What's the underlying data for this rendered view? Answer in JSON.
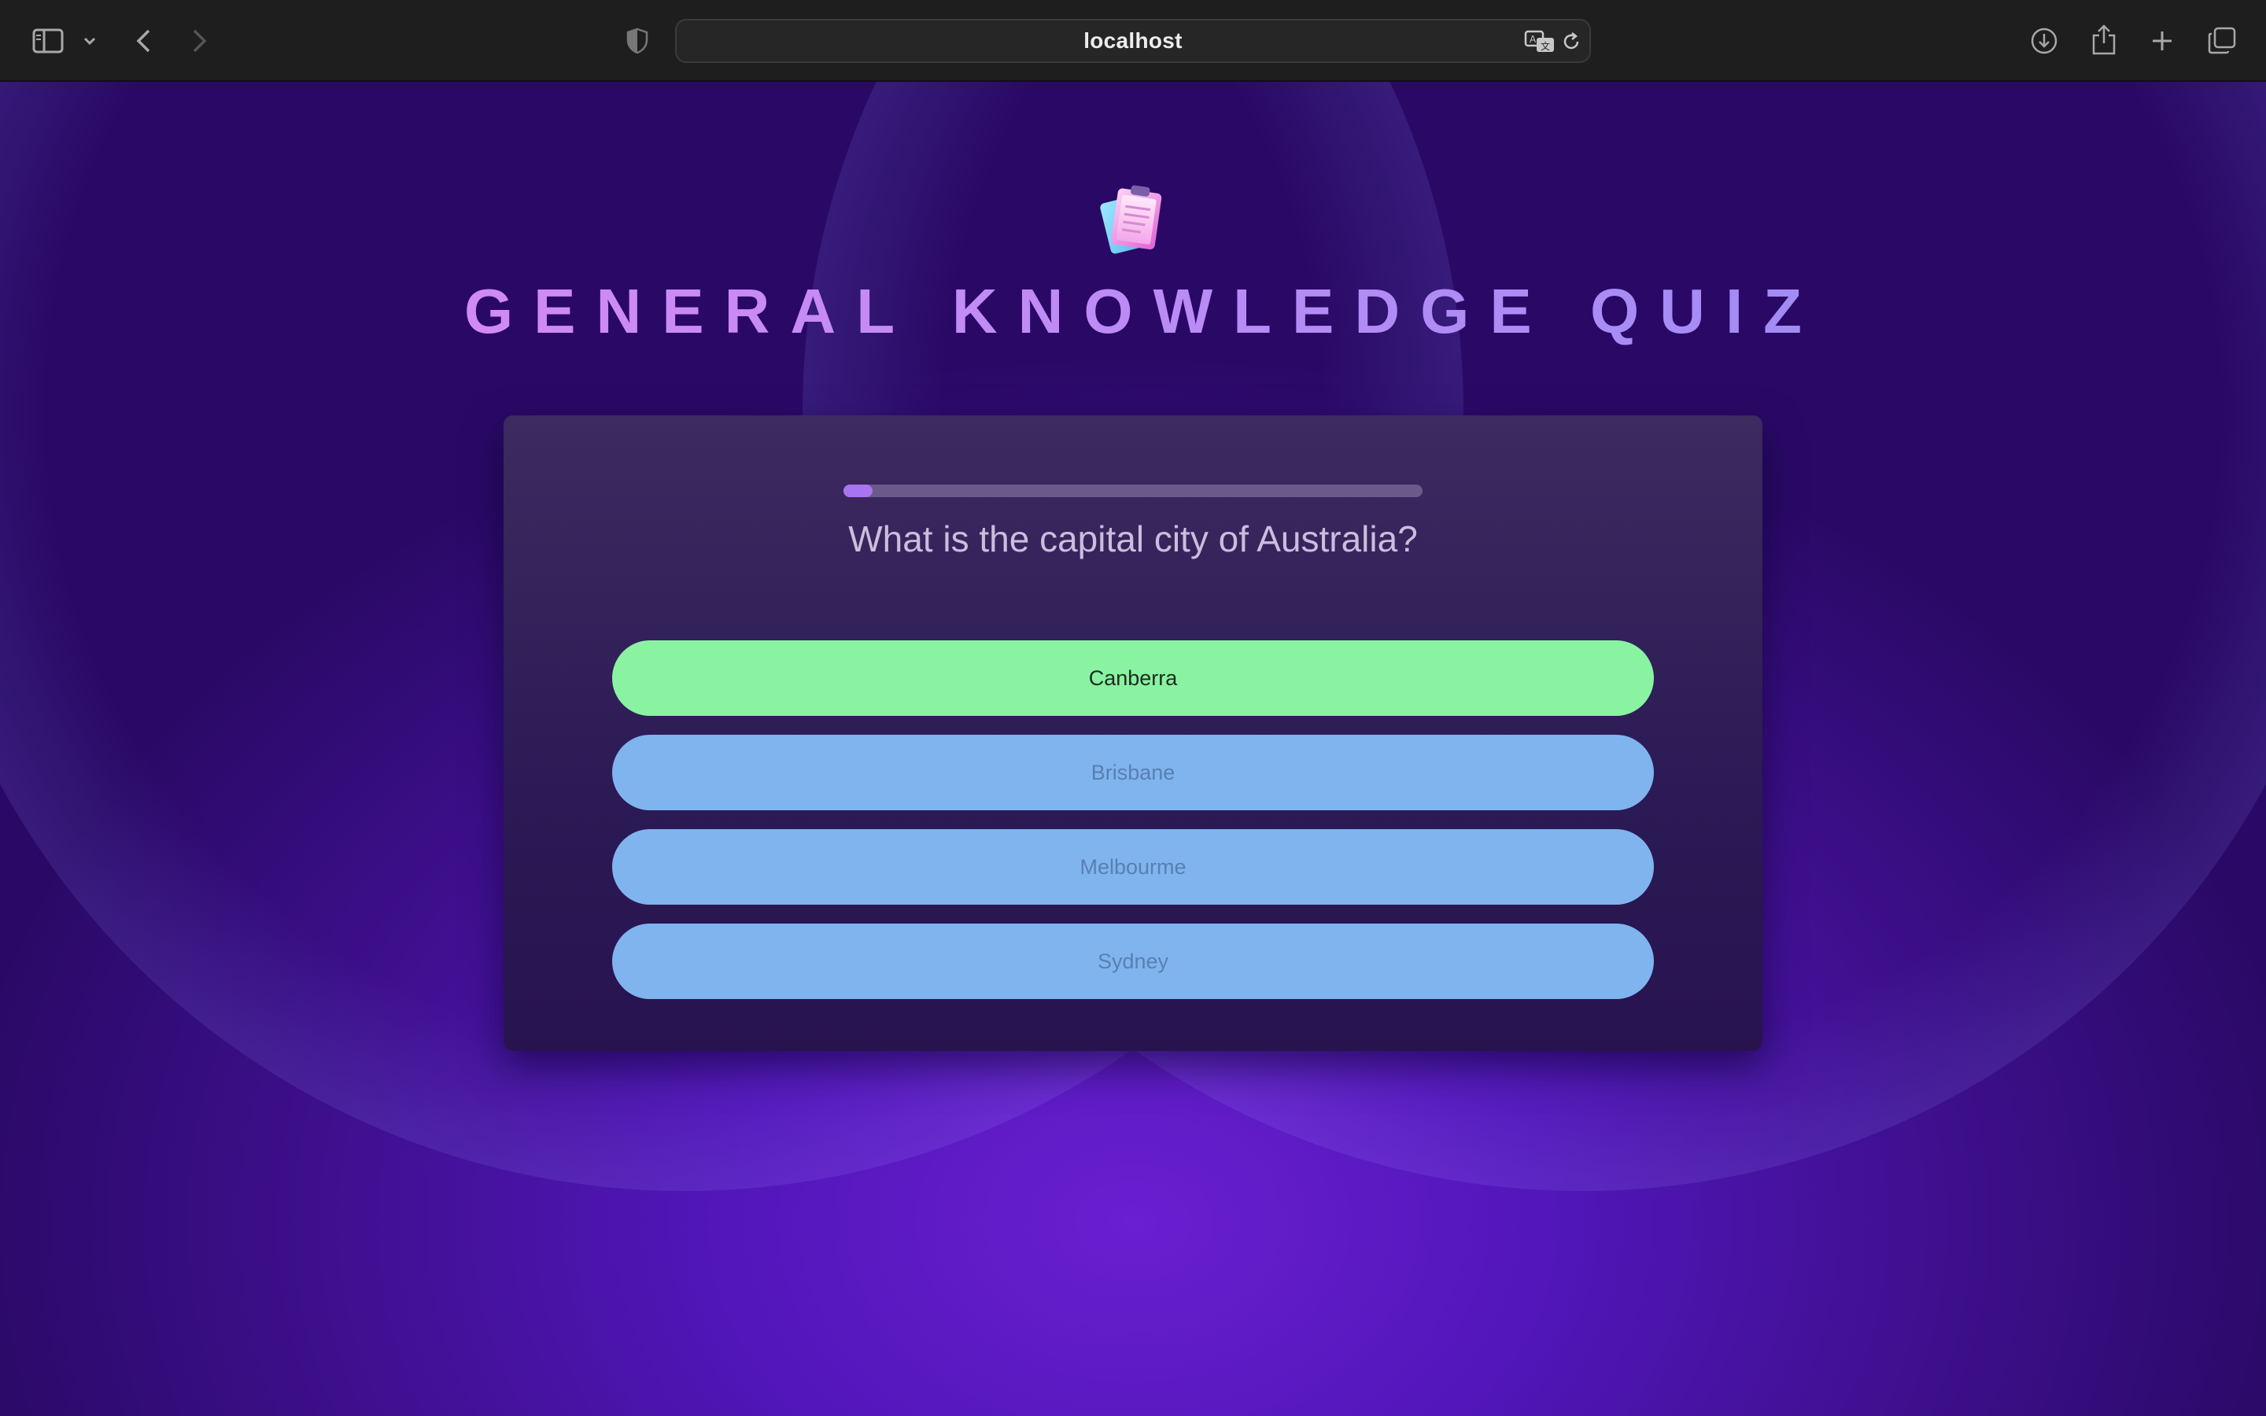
{
  "browser": {
    "address": "localhost"
  },
  "icons": {
    "sidebar": "sidebar-icon",
    "chevron": "chevron-down-icon",
    "back": "back-arrow-icon",
    "forward": "forward-arrow-icon",
    "privacy": "shield-icon",
    "translate": "translate-icon",
    "reload": "reload-icon",
    "download": "download-icon",
    "share": "share-icon",
    "new_tab": "plus-icon",
    "tabs": "tabs-overview-icon",
    "logo": "clipboard-icon"
  },
  "quiz": {
    "title": "GENERAL KNOWLEDGE QUIZ",
    "progress_fraction": 0.05,
    "question": "What is the capital city of Australia?",
    "options": [
      {
        "label": "Canberra",
        "state": "correct"
      },
      {
        "label": "Brisbane",
        "state": "other"
      },
      {
        "label": "Melbourme",
        "state": "other"
      },
      {
        "label": "Sydney",
        "state": "other"
      }
    ]
  },
  "colors": {
    "correct": "#89f3a1",
    "option": "#7fb4ef",
    "accent": "#a974f0"
  }
}
